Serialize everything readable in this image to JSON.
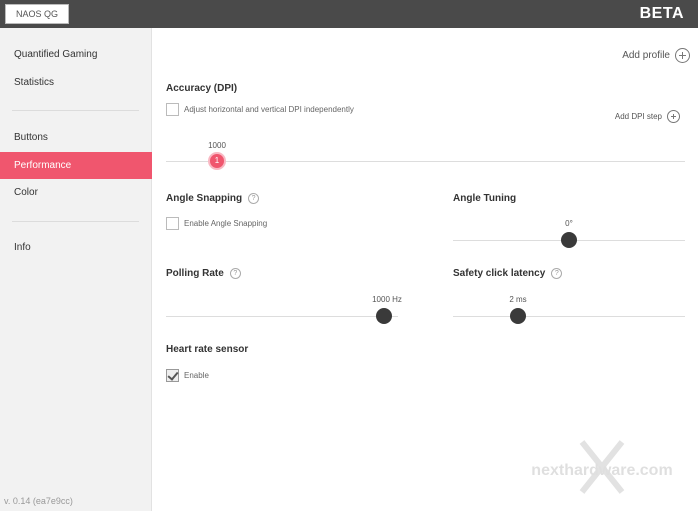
{
  "topbar": {
    "device_tab": "NAOS QG",
    "badge": "BETA"
  },
  "sidebar": {
    "items": [
      {
        "label": "Quantified Gaming"
      },
      {
        "label": "Statistics"
      },
      {
        "label": "Buttons"
      },
      {
        "label": "Performance",
        "active": true
      },
      {
        "label": "Color"
      },
      {
        "label": "Info"
      }
    ],
    "version": "v. 0.14 (ea7e9cc)"
  },
  "main": {
    "add_profile": "Add profile",
    "accuracy": {
      "title": "Accuracy (DPI)",
      "independent_label": "Adjust horizontal and vertical DPI independently",
      "add_dpi_step": "Add DPI step",
      "dpi_value": "1000",
      "dpi_step_index": "1"
    },
    "angle_snapping": {
      "title": "Angle Snapping",
      "checkbox_label": "Enable Angle Snapping"
    },
    "angle_tuning": {
      "title": "Angle Tuning",
      "value": "0°"
    },
    "polling_rate": {
      "title": "Polling Rate",
      "value": "1000 Hz"
    },
    "safety_click": {
      "title": "Safety click latency",
      "value": "2 ms"
    },
    "heart_rate": {
      "title": "Heart rate sensor",
      "checkbox_label": "Enable",
      "checked": true
    },
    "help_glyph": "?",
    "watermark": "nexthardware.com"
  }
}
